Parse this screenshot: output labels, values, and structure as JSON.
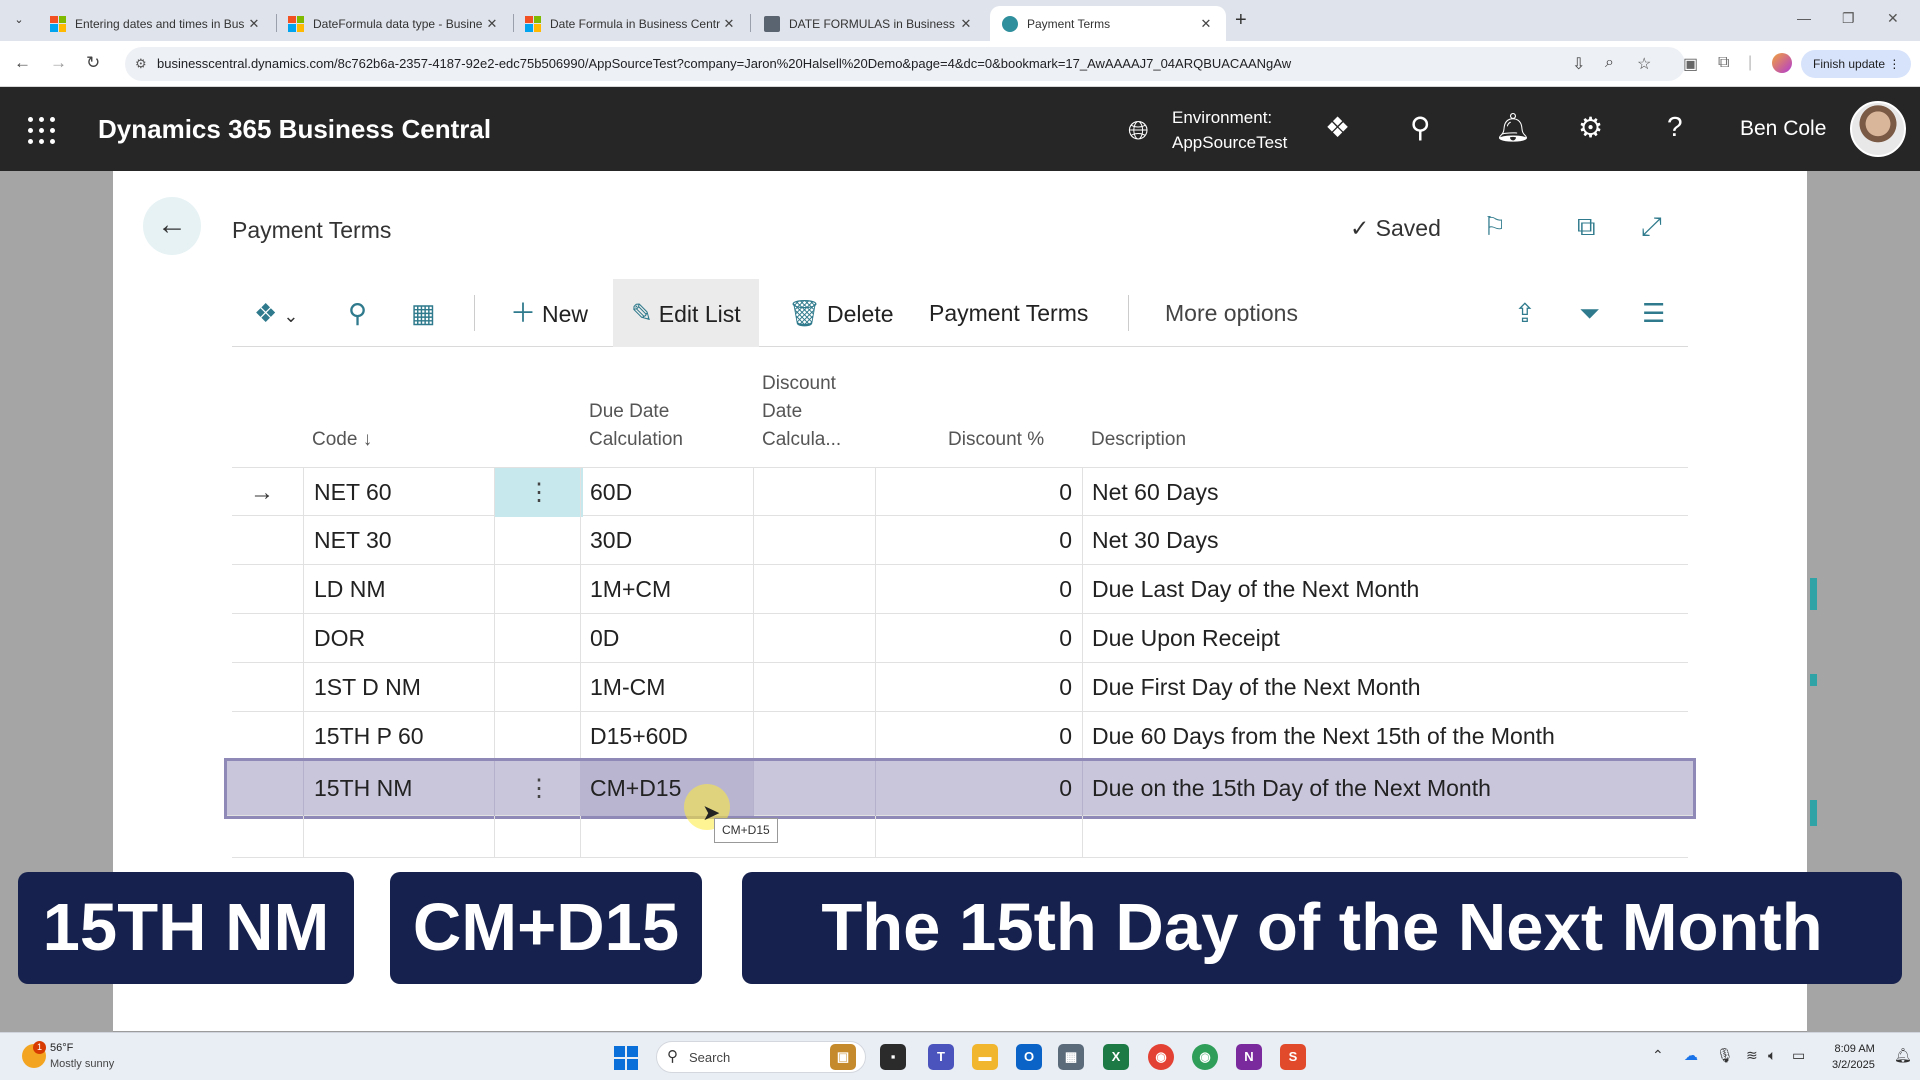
{
  "browser": {
    "tabs": [
      {
        "title": "Entering dates and times in Bus"
      },
      {
        "title": "DateFormula data type - Busine"
      },
      {
        "title": "Date Formula in Business Centr"
      },
      {
        "title": "DATE FORMULAS in Business C"
      },
      {
        "title": "Payment Terms"
      }
    ],
    "url": "businesscentral.dynamics.com/8c762b6a-2357-4187-92e2-edc75b506990/AppSourceTest?company=Jaron%20Halsell%20Demo&page=4&dc=0&bookmark=17_AwAAAAJ7_04ARQBUACAANgAw",
    "finish_update": "Finish update"
  },
  "header": {
    "app_title": "Dynamics 365 Business Central",
    "env_label": "Environment:",
    "env_value": "AppSourceTest",
    "user_name": "Ben Cole"
  },
  "page": {
    "title": "Payment Terms",
    "saved": "Saved",
    "actions": {
      "new": "New",
      "edit_list": "Edit List",
      "delete": "Delete",
      "payment_terms": "Payment Terms",
      "more_options": "More options"
    },
    "columns": {
      "code": "Code ↓",
      "due_date_l1": "Due Date",
      "due_date_l2": "Calculation",
      "discount_date_l1": "Discount",
      "discount_date_l2": "Date",
      "discount_date_l3": "Calcula...",
      "discount_pct": "Discount %",
      "description": "Description"
    },
    "rows": [
      {
        "code": "NET 60",
        "due": "60D",
        "disc_date": "",
        "disc_pct": "0",
        "desc": "Net 60 Days"
      },
      {
        "code": "NET 30",
        "due": "30D",
        "disc_date": "",
        "disc_pct": "0",
        "desc": "Net 30 Days"
      },
      {
        "code": "LD NM",
        "due": "1M+CM",
        "disc_date": "",
        "disc_pct": "0",
        "desc": "Due Last Day of the Next Month"
      },
      {
        "code": "DOR",
        "due": "0D",
        "disc_date": "",
        "disc_pct": "0",
        "desc": "Due Upon Receipt"
      },
      {
        "code": "1ST D NM",
        "due": "1M-CM",
        "disc_date": "",
        "disc_pct": "0",
        "desc": "Due First Day of the Next Month"
      },
      {
        "code": "15TH P 60",
        "due": "D15+60D",
        "disc_date": "",
        "disc_pct": "0",
        "desc": "Due 60 Days from the Next 15th of the Month"
      },
      {
        "code": "15TH NM",
        "due": "CM+D15",
        "disc_date": "",
        "disc_pct": "0",
        "desc": "Due on the 15th Day of the Next Month"
      }
    ],
    "tooltip": "CM+D15"
  },
  "captions": {
    "code": "15TH NM",
    "formula": "CM+D15",
    "meaning": "The 15th Day of the Next Month"
  },
  "taskbar": {
    "weather_temp": "56°F",
    "weather_desc": "Mostly sunny",
    "weather_badge": "1",
    "search": "Search",
    "time": "8:09 AM",
    "date": "3/2/2025"
  },
  "colors": {
    "header_bg": "#262626",
    "accent": "#2f7a8c",
    "selected_row": "#c9c6db",
    "caption_bg": "#16214d"
  }
}
